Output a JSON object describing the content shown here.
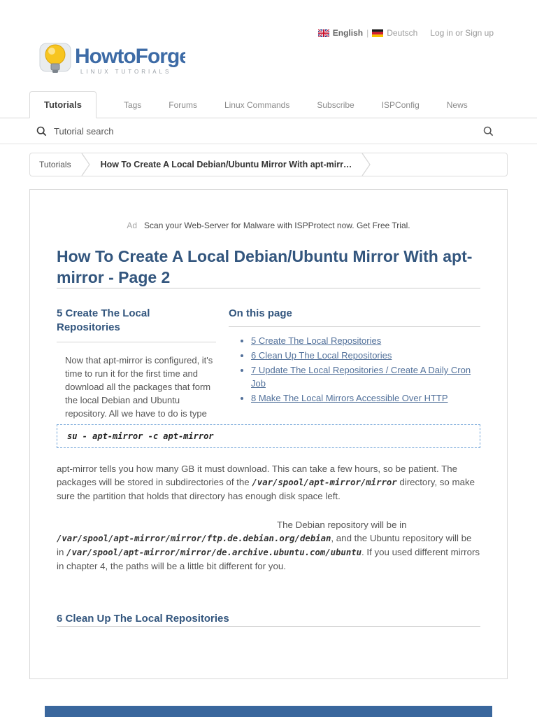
{
  "topbar": {
    "lang_en": "English",
    "lang_sep": "|",
    "lang_de": "Deutsch",
    "login": "Log in or Sign up"
  },
  "logo": {
    "name": "HowtoForge",
    "tagline": "LINUX TUTORIALS"
  },
  "nav": {
    "items": [
      {
        "label": "Tutorials"
      },
      {
        "label": "Tags"
      },
      {
        "label": "Forums"
      },
      {
        "label": "Linux Commands"
      },
      {
        "label": "Subscribe"
      },
      {
        "label": "ISPConfig"
      },
      {
        "label": "News"
      }
    ]
  },
  "search": {
    "placeholder": "Tutorial search"
  },
  "breadcrumb": {
    "items": [
      {
        "label": "Tutorials"
      },
      {
        "label": "How To Create A Local Debian/Ubuntu Mirror With apt-mirr…"
      }
    ]
  },
  "ad": {
    "label": "Ad",
    "text": "Scan your Web-Server for Malware with ISPProtect now. Get Free Trial."
  },
  "article": {
    "title": "How To Create A Local Debian/Ubuntu Mirror With apt-mirror - Page 2",
    "section5_heading": "5 Create The Local Repositories",
    "section5_intro": "Now that apt-mirror is configured, it's time to run it for the first time and download all the packages that form the local Debian and Ubuntu repository. All we have to do is type",
    "toc_heading": "On this page",
    "toc_links": [
      {
        "label": "5 Create The Local Repositories"
      },
      {
        "label": "6 Clean Up The Local Repositories"
      },
      {
        "label": "7 Update The Local Repositories / Create A Daily Cron Job"
      },
      {
        "label": "8 Make The Local Mirrors Accessible Over HTTP"
      }
    ],
    "code_command": "su - apt-mirror -c apt-mirror",
    "p1_before": "apt-mirror tells you how many GB it must download. This can take a few hours, so be patient. The packages will be stored in subdirectories of the ",
    "p1_code": "/var/spool/apt-mirror/mirror",
    "p1_after": " directory, so make sure the partition that holds that directory has enough disk space left.",
    "p2_before": "The Debian repository will be in ",
    "p2_code1": "/var/spool/apt-mirror/mirror/ftp.de.debian.org/debian",
    "p2_mid": ", and the Ubuntu repository will be in ",
    "p2_code2": "/var/spool/apt-mirror/mirror/de.archive.ubuntu.com/ubuntu",
    "p2_after": ". If you used different mirrors in chapter 4, the paths will be a little bit different for you.",
    "section6_heading": "6 Clean Up The Local Repositories"
  },
  "colors": {
    "heading_navy": "#33567e",
    "link_blue": "#51709a",
    "code_border_blue": "#6fa3d8",
    "footer_bar_blue": "#3a679d"
  }
}
